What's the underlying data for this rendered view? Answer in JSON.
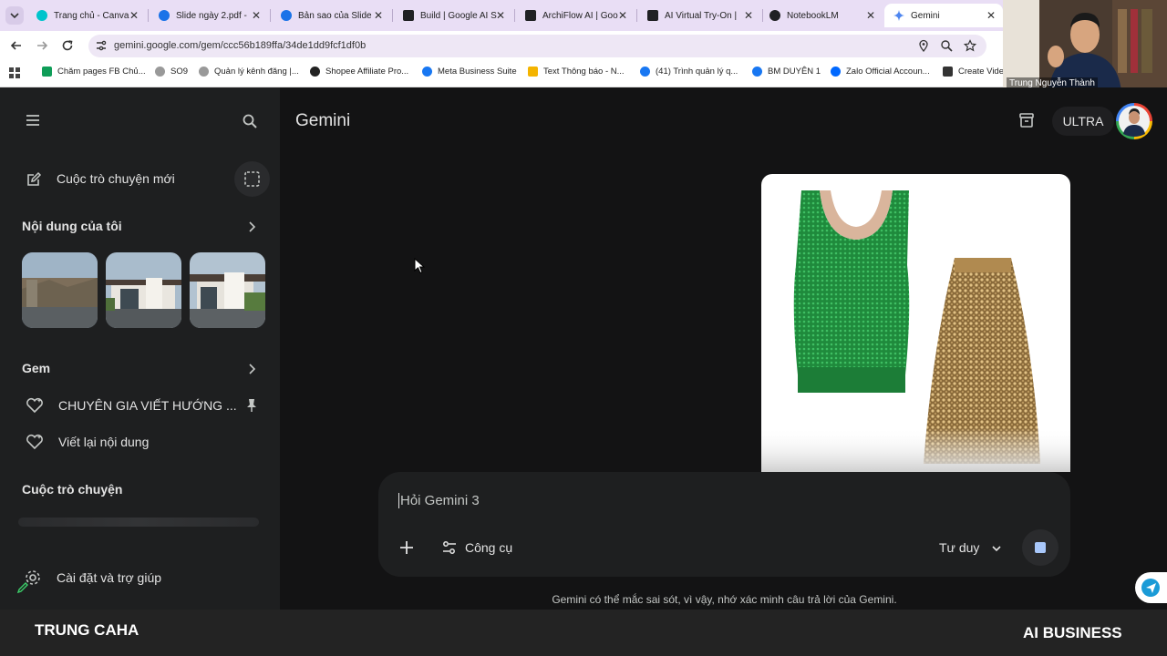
{
  "browser": {
    "tabs": [
      {
        "title": "Trang chủ - Canva",
        "color": "#00c4cc"
      },
      {
        "title": "Slide ngày 2.pdf -",
        "color": "#1a73e8"
      },
      {
        "title": "Bản sao của Slide",
        "color": "#1a73e8"
      },
      {
        "title": "Build | Google AI S",
        "color": "#202124"
      },
      {
        "title": "ArchiFlow AI | Goo",
        "color": "#202124"
      },
      {
        "title": "AI Virtual Try-On |",
        "color": "#202124"
      },
      {
        "title": "NotebookLM",
        "color": "#202124"
      },
      {
        "title": "Gemini",
        "color": "#4e86f0"
      }
    ],
    "url": "gemini.google.com/gem/ccc56b189ffa/34de1dd9fcf1df0b",
    "bookmarks": [
      "Chăm pages FB Chủ...",
      "SO9",
      "Quản lý kênh đăng |...",
      "Shopee Affiliate Pro...",
      "Meta Business Suite",
      "Text Thông báo - N...",
      "(41) Trình quản lý q...",
      "BM DUYÊN 1",
      "Zalo Official Accoun...",
      "Create Vide"
    ]
  },
  "webcam": {
    "name": "Trung Nguyễn Thành"
  },
  "sidebar": {
    "new_chat": "Cuộc trò chuyện mới",
    "my_content": "Nội dung của tôi",
    "gem_section": "Gem",
    "gems": [
      "CHUYÊN GIA VIẾT HƯỚNG ...",
      "Viết lại nội dung"
    ],
    "chats_section": "Cuộc trò chuyện",
    "settings": "Cài đặt và trợ giúp"
  },
  "header": {
    "title": "Gemini",
    "plan_badge": "ULTRA"
  },
  "composer": {
    "placeholder": "Hỏi Gemini 3",
    "tools_label": "Công cụ",
    "mode_label": "Tư duy"
  },
  "disclaimer": "Gemini có thể mắc sai sót, vì vậy, nhớ xác minh câu trả lời của Gemini.",
  "footer": {
    "left_brand": "TRUNG CAHA",
    "right_brand": "AI BUSINESS"
  },
  "colors": {
    "accent": "#4e86f0",
    "bg": "#131314",
    "sidebar": "#1e1f20"
  }
}
